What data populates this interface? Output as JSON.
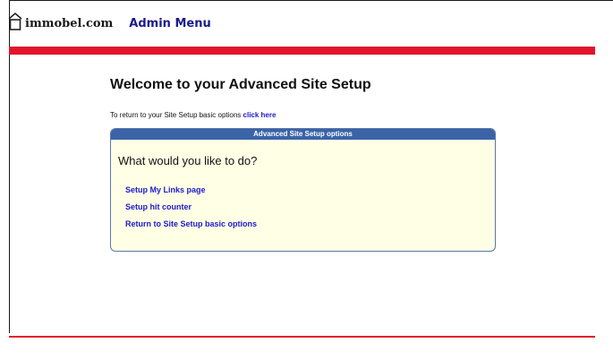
{
  "header": {
    "logo_text": "immobel.com",
    "admin_menu": "Admin Menu"
  },
  "page": {
    "title": "Welcome to your Advanced Site Setup",
    "return_text": "To return to your Site Setup basic options ",
    "return_link": "click here"
  },
  "panel": {
    "header": "Advanced Site Setup options",
    "question": "What would you like to do?",
    "links": [
      "Setup My Links page",
      "Setup hit counter",
      "Return to Site Setup basic options"
    ]
  },
  "colors": {
    "accent_red": "#e3142a",
    "link_blue": "#1a1acc",
    "panel_header_blue": "#3a63a8",
    "panel_bg": "#ffffe6"
  }
}
